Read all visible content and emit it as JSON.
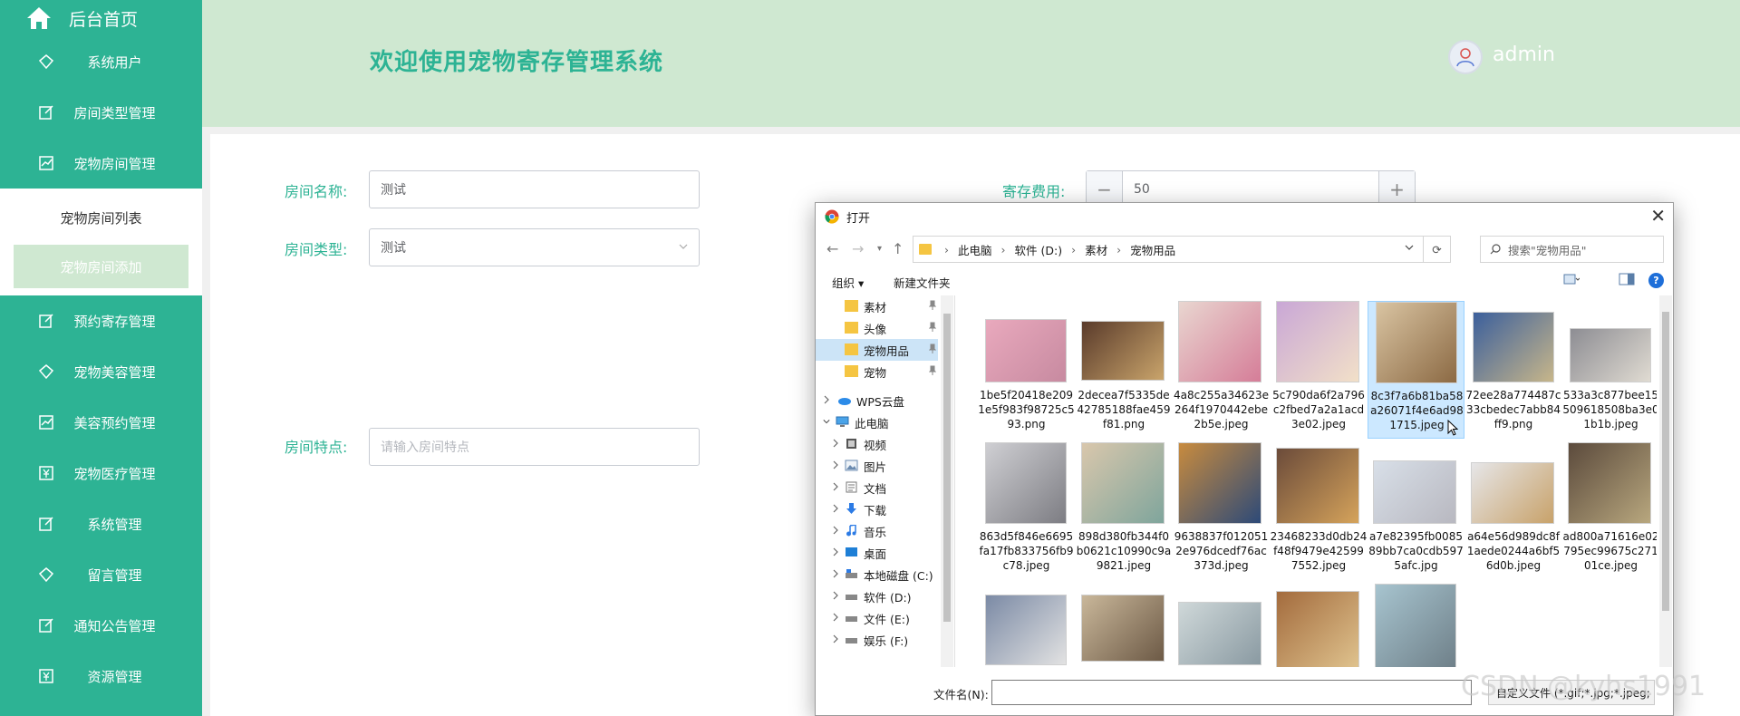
{
  "sidebar": {
    "home": "后台首页",
    "items_top": [
      "系统用户",
      "房间类型管理",
      "宠物房间管理"
    ],
    "sub_items": [
      "宠物房间列表",
      "宠物房间添加"
    ],
    "items_bottom": [
      "预约寄存管理",
      "宠物美容管理",
      "美容预约管理",
      "宠物医疗管理",
      "系统管理",
      "留言管理",
      "通知公告管理",
      "资源管理"
    ]
  },
  "header": {
    "title": "欢迎使用宠物寄存管理系统",
    "user": "admin"
  },
  "form": {
    "room_name_label": "房间名称:",
    "room_name_value": "测试",
    "room_type_label": "房间类型:",
    "room_type_value": "测试",
    "fee_label": "寄存费用:",
    "fee_minus": "−",
    "fee_value": "50",
    "fee_plus": "+",
    "features_label": "房间特点:",
    "features_placeholder": "请输入房间特点"
  },
  "dialog": {
    "title": "打开",
    "close": "✕",
    "path": [
      "此电脑",
      "软件 (D:)",
      "素材",
      "宠物用品"
    ],
    "search_placeholder": "搜索\"宠物用品\"",
    "organize": "组织 ▾",
    "new_folder": "新建文件夹",
    "help": "?",
    "nav_items": [
      "素材",
      "头像",
      "宠物用品",
      "宠物",
      "WPS云盘",
      "此电脑",
      "视频",
      "图片",
      "文档",
      "下载",
      "音乐",
      "桌面",
      "本地磁盘 (C:)",
      "软件 (D:)",
      "文件 (E:)",
      "娱乐 (F:)"
    ],
    "files": [
      "1be5f20418e2091e5f983f98725c593.png",
      "2decea7f5335de42785188fae459f81.png",
      "4a8c255a34623e264f1970442ebe2b5e.jpeg",
      "5c790da6f2a796c2fbed7a2a1acd3e02.jpeg",
      "8c3f7a6b81ba58a26071f4e6ad981715.jpeg",
      "72ee28a774487c33cbedec7abb84ff9.png",
      "533a3c877bee15509618508ba3e01b1b.jpeg",
      "863d5f846e6695fa17fb833756fb9c78.jpeg",
      "898d380fb344f0b0621c10990c9a9821.jpeg",
      "9638837f0120512e976dcedf76ac373d.jpeg",
      "23468233d0db24f48f9479e425997552.jpeg",
      "a7e82395fb008589bb7ca0cdb5975afc.jpg",
      "a64e56d989dc8f1aede0244a6bf56d0b.jpeg",
      "ad800a71616e02795ec99675c27101ce.jpeg"
    ],
    "filename_label": "文件名(N):",
    "filetype": "自定义文件 (*.gif;*.jpg;*.jpeg;"
  },
  "watermark": "CSDN @kyhs1991"
}
